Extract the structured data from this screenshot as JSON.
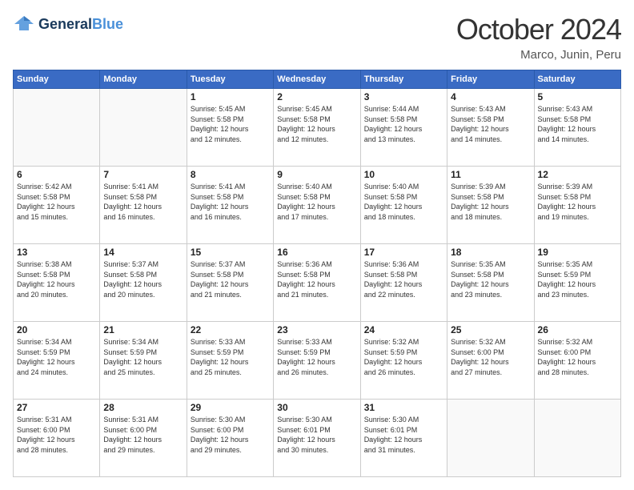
{
  "logo": {
    "line1": "General",
    "line2": "Blue"
  },
  "title": "October 2024",
  "location": "Marco, Junin, Peru",
  "days_header": [
    "Sunday",
    "Monday",
    "Tuesday",
    "Wednesday",
    "Thursday",
    "Friday",
    "Saturday"
  ],
  "weeks": [
    [
      {
        "day": "",
        "content": ""
      },
      {
        "day": "",
        "content": ""
      },
      {
        "day": "1",
        "content": "Sunrise: 5:45 AM\nSunset: 5:58 PM\nDaylight: 12 hours\nand 12 minutes."
      },
      {
        "day": "2",
        "content": "Sunrise: 5:45 AM\nSunset: 5:58 PM\nDaylight: 12 hours\nand 12 minutes."
      },
      {
        "day": "3",
        "content": "Sunrise: 5:44 AM\nSunset: 5:58 PM\nDaylight: 12 hours\nand 13 minutes."
      },
      {
        "day": "4",
        "content": "Sunrise: 5:43 AM\nSunset: 5:58 PM\nDaylight: 12 hours\nand 14 minutes."
      },
      {
        "day": "5",
        "content": "Sunrise: 5:43 AM\nSunset: 5:58 PM\nDaylight: 12 hours\nand 14 minutes."
      }
    ],
    [
      {
        "day": "6",
        "content": "Sunrise: 5:42 AM\nSunset: 5:58 PM\nDaylight: 12 hours\nand 15 minutes."
      },
      {
        "day": "7",
        "content": "Sunrise: 5:41 AM\nSunset: 5:58 PM\nDaylight: 12 hours\nand 16 minutes."
      },
      {
        "day": "8",
        "content": "Sunrise: 5:41 AM\nSunset: 5:58 PM\nDaylight: 12 hours\nand 16 minutes."
      },
      {
        "day": "9",
        "content": "Sunrise: 5:40 AM\nSunset: 5:58 PM\nDaylight: 12 hours\nand 17 minutes."
      },
      {
        "day": "10",
        "content": "Sunrise: 5:40 AM\nSunset: 5:58 PM\nDaylight: 12 hours\nand 18 minutes."
      },
      {
        "day": "11",
        "content": "Sunrise: 5:39 AM\nSunset: 5:58 PM\nDaylight: 12 hours\nand 18 minutes."
      },
      {
        "day": "12",
        "content": "Sunrise: 5:39 AM\nSunset: 5:58 PM\nDaylight: 12 hours\nand 19 minutes."
      }
    ],
    [
      {
        "day": "13",
        "content": "Sunrise: 5:38 AM\nSunset: 5:58 PM\nDaylight: 12 hours\nand 20 minutes."
      },
      {
        "day": "14",
        "content": "Sunrise: 5:37 AM\nSunset: 5:58 PM\nDaylight: 12 hours\nand 20 minutes."
      },
      {
        "day": "15",
        "content": "Sunrise: 5:37 AM\nSunset: 5:58 PM\nDaylight: 12 hours\nand 21 minutes."
      },
      {
        "day": "16",
        "content": "Sunrise: 5:36 AM\nSunset: 5:58 PM\nDaylight: 12 hours\nand 21 minutes."
      },
      {
        "day": "17",
        "content": "Sunrise: 5:36 AM\nSunset: 5:58 PM\nDaylight: 12 hours\nand 22 minutes."
      },
      {
        "day": "18",
        "content": "Sunrise: 5:35 AM\nSunset: 5:58 PM\nDaylight: 12 hours\nand 23 minutes."
      },
      {
        "day": "19",
        "content": "Sunrise: 5:35 AM\nSunset: 5:59 PM\nDaylight: 12 hours\nand 23 minutes."
      }
    ],
    [
      {
        "day": "20",
        "content": "Sunrise: 5:34 AM\nSunset: 5:59 PM\nDaylight: 12 hours\nand 24 minutes."
      },
      {
        "day": "21",
        "content": "Sunrise: 5:34 AM\nSunset: 5:59 PM\nDaylight: 12 hours\nand 25 minutes."
      },
      {
        "day": "22",
        "content": "Sunrise: 5:33 AM\nSunset: 5:59 PM\nDaylight: 12 hours\nand 25 minutes."
      },
      {
        "day": "23",
        "content": "Sunrise: 5:33 AM\nSunset: 5:59 PM\nDaylight: 12 hours\nand 26 minutes."
      },
      {
        "day": "24",
        "content": "Sunrise: 5:32 AM\nSunset: 5:59 PM\nDaylight: 12 hours\nand 26 minutes."
      },
      {
        "day": "25",
        "content": "Sunrise: 5:32 AM\nSunset: 6:00 PM\nDaylight: 12 hours\nand 27 minutes."
      },
      {
        "day": "26",
        "content": "Sunrise: 5:32 AM\nSunset: 6:00 PM\nDaylight: 12 hours\nand 28 minutes."
      }
    ],
    [
      {
        "day": "27",
        "content": "Sunrise: 5:31 AM\nSunset: 6:00 PM\nDaylight: 12 hours\nand 28 minutes."
      },
      {
        "day": "28",
        "content": "Sunrise: 5:31 AM\nSunset: 6:00 PM\nDaylight: 12 hours\nand 29 minutes."
      },
      {
        "day": "29",
        "content": "Sunrise: 5:30 AM\nSunset: 6:00 PM\nDaylight: 12 hours\nand 29 minutes."
      },
      {
        "day": "30",
        "content": "Sunrise: 5:30 AM\nSunset: 6:01 PM\nDaylight: 12 hours\nand 30 minutes."
      },
      {
        "day": "31",
        "content": "Sunrise: 5:30 AM\nSunset: 6:01 PM\nDaylight: 12 hours\nand 31 minutes."
      },
      {
        "day": "",
        "content": ""
      },
      {
        "day": "",
        "content": ""
      }
    ]
  ]
}
